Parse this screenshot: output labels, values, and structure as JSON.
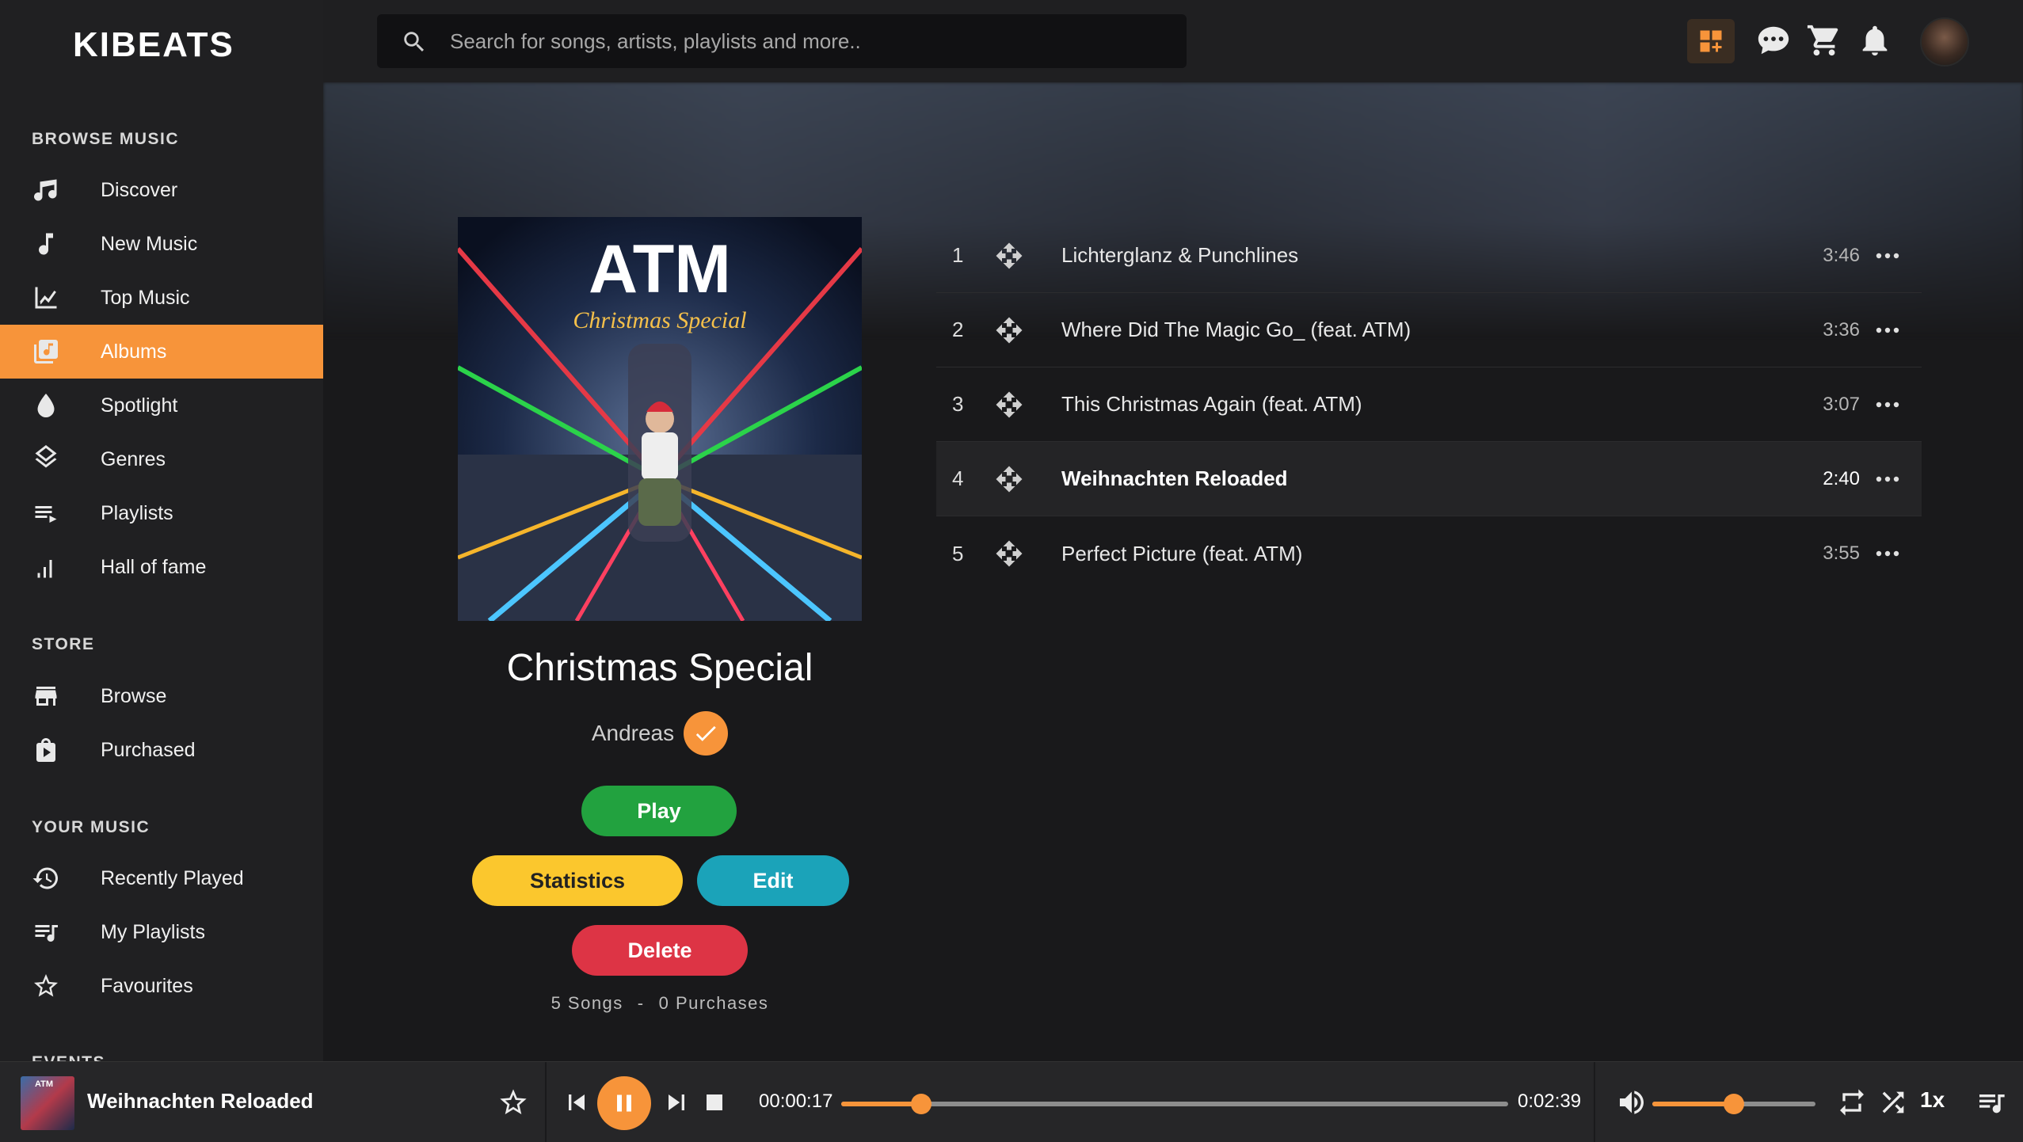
{
  "app": {
    "logo": "KIBEATS"
  },
  "search": {
    "placeholder": "Search for songs, artists, playlists and more.."
  },
  "sidebar": {
    "sections": [
      {
        "title": "BROWSE MUSIC"
      },
      {
        "title": "STORE"
      },
      {
        "title": "YOUR MUSIC"
      },
      {
        "title": "EVENTS"
      }
    ],
    "browse": [
      {
        "label": "Discover",
        "icon": "music-notes-icon"
      },
      {
        "label": "New Music",
        "icon": "music-note-icon"
      },
      {
        "label": "Top Music",
        "icon": "chart-line-icon"
      },
      {
        "label": "Albums",
        "icon": "album-library-icon",
        "active": true
      },
      {
        "label": "Spotlight",
        "icon": "drop-icon"
      },
      {
        "label": "Genres",
        "icon": "layers-icon"
      },
      {
        "label": "Playlists",
        "icon": "playlist-icon"
      },
      {
        "label": "Hall of fame",
        "icon": "bar-chart-icon"
      }
    ],
    "store": [
      {
        "label": "Browse",
        "icon": "store-icon"
      },
      {
        "label": "Purchased",
        "icon": "purchased-bag-icon"
      }
    ],
    "your_music": [
      {
        "label": "Recently Played",
        "icon": "history-icon"
      },
      {
        "label": "My Playlists",
        "icon": "playlist-music-icon"
      },
      {
        "label": "Favourites",
        "icon": "star-outline-icon"
      }
    ]
  },
  "topbar_icons": [
    "dashboard-add-icon",
    "chat-icon",
    "cart-icon",
    "bell-icon",
    "avatar"
  ],
  "album": {
    "cover_text": "ATM",
    "cover_subtitle": "Christmas Special",
    "title": "Christmas Special",
    "artist": "Andreas",
    "buttons": {
      "play": "Play",
      "statistics": "Statistics",
      "edit": "Edit",
      "delete": "Delete"
    },
    "songs_count": "5 Songs",
    "separator": "-",
    "purchases": "0 Purchases"
  },
  "tracks": [
    {
      "num": "1",
      "title": "Lichterglanz & Punchlines",
      "duration": "3:46"
    },
    {
      "num": "2",
      "title": "Where Did The Magic Go_ (feat. ATM)",
      "duration": "3:36"
    },
    {
      "num": "3",
      "title": "This Christmas Again (feat. ATM)",
      "duration": "3:07"
    },
    {
      "num": "4",
      "title": "Weihnachten Reloaded",
      "duration": "2:40",
      "current": true
    },
    {
      "num": "5",
      "title": "Perfect Picture (feat. ATM)",
      "duration": "3:55"
    }
  ],
  "player": {
    "thumb_text": "ATM",
    "title": "Weihnachten Reloaded",
    "elapsed": "00:00:17",
    "total": "0:02:39",
    "progress": 0.12,
    "volume": 0.5,
    "speed": "1x"
  },
  "colors": {
    "accent": "#f7943a",
    "play": "#22a23f",
    "statistics": "#fbc72d",
    "edit": "#1ba3b9",
    "delete": "#dd3445"
  }
}
